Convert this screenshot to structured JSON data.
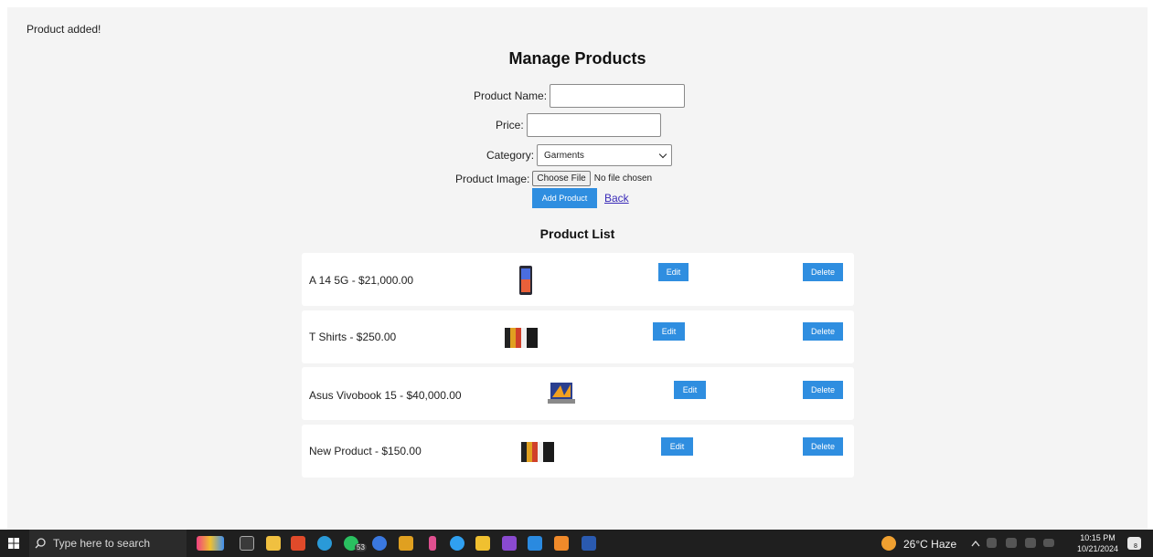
{
  "flash_message": "Product added!",
  "page_title": "Manage Products",
  "form": {
    "product_name_label": "Product Name:",
    "price_label": "Price:",
    "category_label": "Category:",
    "category_selected": "Garments",
    "image_label": "Product Image:",
    "choose_file_label": "Choose File",
    "file_status": "No file chosen",
    "add_button": "Add Product",
    "back_link": "Back"
  },
  "product_list_title": "Product List",
  "products": [
    {
      "text": "A 14 5G - $21,000.00",
      "edit": "Edit",
      "delete": "Delete"
    },
    {
      "text": "T Shirts - $250.00",
      "edit": "Edit",
      "delete": "Delete"
    },
    {
      "text": "Asus Vivobook 15 - $40,000.00",
      "edit": "Edit",
      "delete": "Delete"
    },
    {
      "text": "New Product - $150.00",
      "edit": "Edit",
      "delete": "Delete"
    }
  ],
  "taskbar": {
    "search_placeholder": "Type here to search",
    "whatsapp_badge": "53",
    "weather": "26°C  Haze",
    "time": "10:15 PM",
    "date": "10/21/2024",
    "notification_count": "8"
  },
  "colors": {
    "accent": "#2f8ee0",
    "page_bg": "#f4f4f4",
    "card_bg": "#ffffff",
    "link": "#3a2bb8",
    "taskbar": "#1f1f1f"
  }
}
